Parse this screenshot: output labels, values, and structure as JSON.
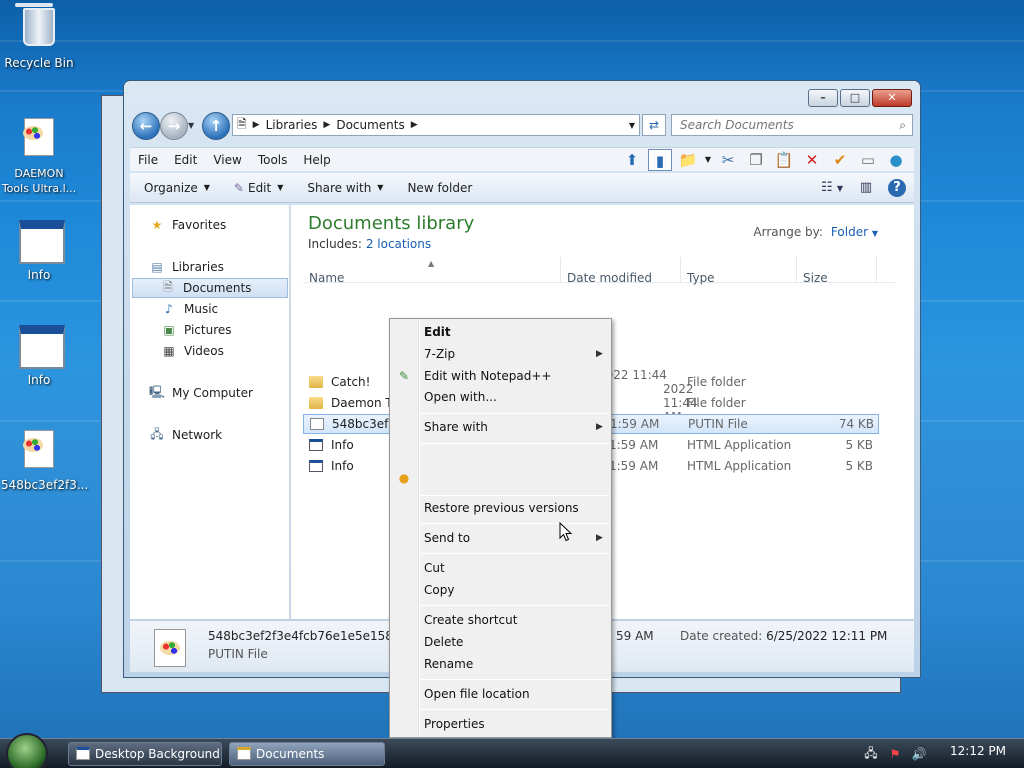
{
  "desktop": {
    "icons": [
      {
        "label": "Recycle Bin",
        "icon": "recycle-bin-icon"
      },
      {
        "label": "DAEMON Tools Ultra.l...",
        "icon": "palette-file-icon"
      },
      {
        "label": "Info",
        "icon": "window-icon"
      },
      {
        "label": "Info",
        "icon": "window-icon"
      },
      {
        "label": "548bc3ef2f3...",
        "icon": "palette-file-icon"
      }
    ]
  },
  "window": {
    "address": {
      "crumbs": [
        "Libraries",
        "Documents"
      ]
    },
    "search": {
      "placeholder": "Search Documents"
    },
    "menu": [
      "File",
      "Edit",
      "View",
      "Tools",
      "Help"
    ],
    "toolbar": {
      "organize": "Organize",
      "edit": "Edit",
      "share_with": "Share with",
      "new_folder": "New folder"
    },
    "nav": {
      "favorites": "Favorites",
      "libraries": "Libraries",
      "documents": "Documents",
      "music": "Music",
      "pictures": "Pictures",
      "videos": "Videos",
      "my_computer": "My Computer",
      "network": "Network"
    },
    "library": {
      "title": "Documents library",
      "includes_label": "Includes:",
      "includes_link": "2 locations",
      "arrange_label": "Arrange by:",
      "arrange_value": "Folder"
    },
    "columns": [
      "Name",
      "Date modified",
      "Type",
      "Size"
    ],
    "files": [
      {
        "name": "Catch!",
        "date": "6/25/2022 11:44 AM",
        "type": "File folder",
        "size": ""
      },
      {
        "name": "Daemon To",
        "date": "2022 11:44 AM",
        "type": "File folder",
        "size": ""
      },
      {
        "name": "548bc3ef2f3",
        "date": "2022 11:59 AM",
        "type": "PUTIN File",
        "size": "74 KB"
      },
      {
        "name": "Info",
        "date": "2022 11:59 AM",
        "type": "HTML Application",
        "size": "5 KB"
      },
      {
        "name": "Info",
        "date": "2022 11:59 AM",
        "type": "HTML Application",
        "size": "5 KB"
      }
    ],
    "details": {
      "filename": "548bc3ef2f3e4fcb76e1e5e1580",
      "filetype": "PUTIN File",
      "modified_tail": "59 AM",
      "created_label": "Date created:",
      "created_value": "6/25/2022 12:11 PM"
    }
  },
  "context_menu": {
    "edit": "Edit",
    "seven_zip": "7-Zip",
    "edit_notepad": "Edit with Notepad++",
    "open_with": "Open with...",
    "share_with": "Share with",
    "restore": "Restore previous versions",
    "send_to": "Send to",
    "cut": "Cut",
    "copy": "Copy",
    "create_shortcut": "Create shortcut",
    "delete": "Delete",
    "rename": "Rename",
    "open_location": "Open file location",
    "properties": "Properties"
  },
  "taskbar": {
    "items": [
      "Desktop Background",
      "Documents"
    ],
    "clock": "12:12 PM"
  }
}
